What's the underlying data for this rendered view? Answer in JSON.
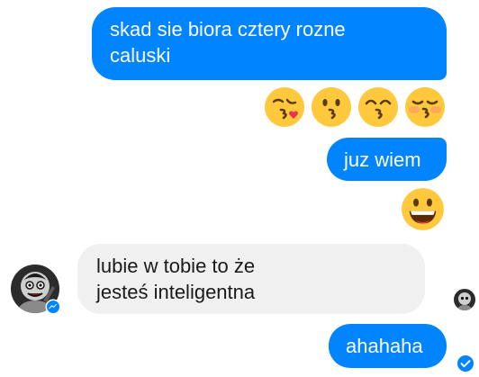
{
  "messages": [
    {
      "direction": "outgoing",
      "text": "skad sie biora cztery rozne\ncaluski"
    },
    {
      "direction": "outgoing",
      "text": "juz wiem"
    },
    {
      "direction": "incoming",
      "text": "lubie w tobie to że\njesteś inteligentna"
    },
    {
      "direction": "outgoing",
      "text": "ahahaha"
    }
  ],
  "emoji_row": [
    "kissing-face-with-heart-icon",
    "kissing-face-icon",
    "kissing-face-with-smiling-eyes-icon",
    "kissing-face-with-closed-eyes-icon"
  ],
  "reaction_emoji": "grinning-face-icon",
  "contact_avatar_icon": "contact-avatar",
  "status": {
    "seen_icon": "seen-avatar-icon",
    "delivered_icon": "delivered-check-icon"
  },
  "colors": {
    "outgoing_bubble": "#0084ff",
    "incoming_bubble": "#f1f0f0",
    "emoji_face": "#ffc83d"
  }
}
